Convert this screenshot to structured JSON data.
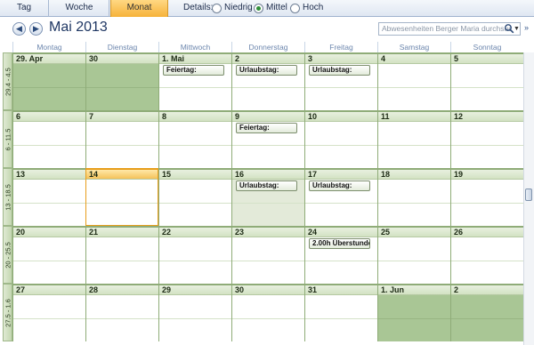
{
  "view_tabs": [
    "Tag",
    "Woche",
    "Monat"
  ],
  "active_tab": "Monat",
  "details": {
    "label": "Details:",
    "options": [
      "Niedrig",
      "Mittel",
      "Hoch"
    ],
    "selected": "Mittel"
  },
  "month_title": "Mai 2013",
  "search": {
    "placeholder": "Abwesenheiten Berger Maria durchsuc"
  },
  "icons": {
    "nav_back": "arrow-left-icon",
    "nav_forward": "arrow-right-icon",
    "search": "magnifier-icon",
    "dropdown": "chevron-down-icon",
    "expand": "double-chevron-icon"
  },
  "day_names": [
    "Montag",
    "Dienstag",
    "Mittwoch",
    "Donnerstag",
    "Freitag",
    "Samstag",
    "Sonntag"
  ],
  "colors": {
    "accent": "#f6b23a",
    "grid_line": "#8fac78",
    "off_day": "#a9c695",
    "highlight_day": "#e3ead9"
  },
  "weeks": [
    {
      "label": "29.4 - 4.5",
      "days": [
        {
          "label": "29. Apr",
          "state": "grey"
        },
        {
          "label": "30",
          "state": "grey"
        },
        {
          "label": "1. Mai",
          "appointment": "Feiertag:"
        },
        {
          "label": "2",
          "appointment": "Urlaubstag:"
        },
        {
          "label": "3",
          "appointment": "Urlaubstag:"
        },
        {
          "label": "4"
        },
        {
          "label": "5"
        }
      ]
    },
    {
      "label": "6 - 11.5",
      "days": [
        {
          "label": "6"
        },
        {
          "label": "7"
        },
        {
          "label": "8"
        },
        {
          "label": "9",
          "appointment": "Feiertag:"
        },
        {
          "label": "10"
        },
        {
          "label": "11"
        },
        {
          "label": "12"
        }
      ]
    },
    {
      "label": "13 - 18.5",
      "days": [
        {
          "label": "13"
        },
        {
          "label": "14",
          "state": "today"
        },
        {
          "label": "15"
        },
        {
          "label": "16",
          "appointment": "Urlaubstag:",
          "state": "soft"
        },
        {
          "label": "17",
          "appointment": "Urlaubstag:"
        },
        {
          "label": "18"
        },
        {
          "label": "19"
        }
      ]
    },
    {
      "label": "20 - 25.5",
      "days": [
        {
          "label": "20"
        },
        {
          "label": "21"
        },
        {
          "label": "22"
        },
        {
          "label": "23"
        },
        {
          "label": "24",
          "appointment": "2.00h Überstunden"
        },
        {
          "label": "25"
        },
        {
          "label": "26"
        }
      ]
    },
    {
      "label": "27.5 - 1.6",
      "days": [
        {
          "label": "27"
        },
        {
          "label": "28"
        },
        {
          "label": "29"
        },
        {
          "label": "30"
        },
        {
          "label": "31"
        },
        {
          "label": "1. Jun",
          "state": "grey"
        },
        {
          "label": "2",
          "state": "grey"
        }
      ]
    }
  ]
}
